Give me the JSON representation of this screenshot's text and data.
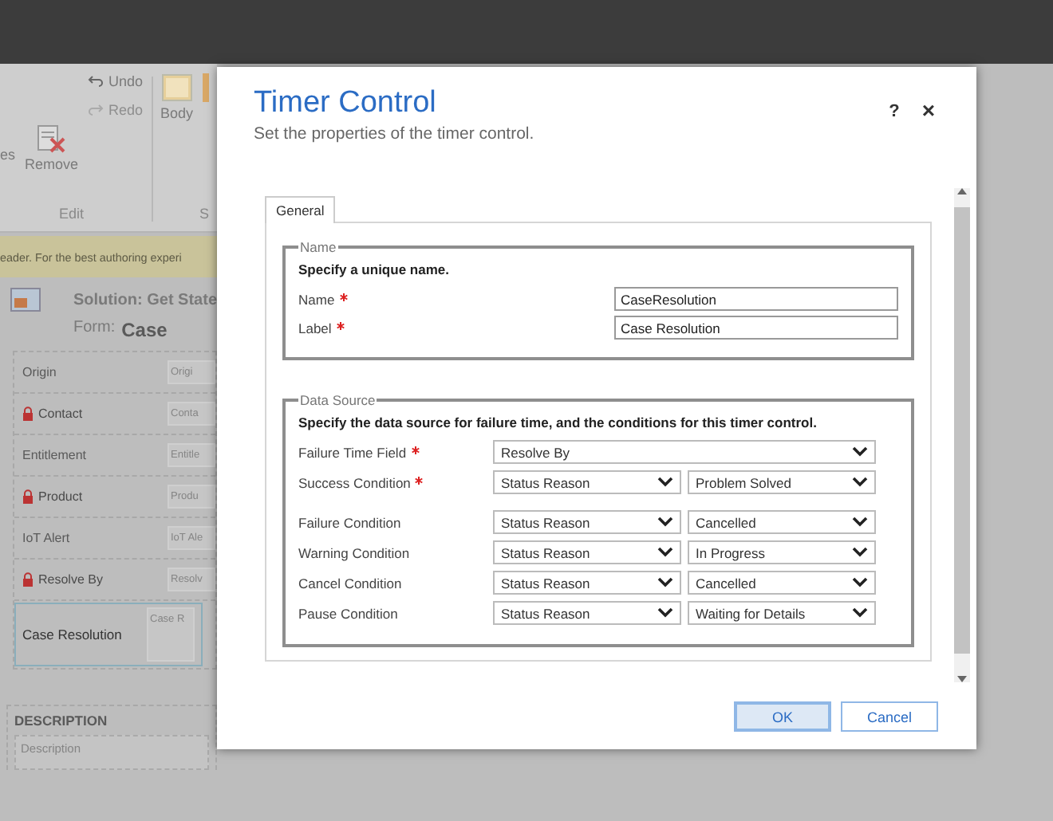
{
  "ribbon": {
    "fragment": "es",
    "remove": "Remove",
    "undo": "Undo",
    "redo": "Redo",
    "redo_disabled": true,
    "body": "Body",
    "group_label": "Edit",
    "group_label_2": "S"
  },
  "notice": "eader. For the best authoring experi",
  "solution": "Solution: Get State",
  "form_label": "Form:",
  "form_name": "Case",
  "fields": [
    {
      "label": "Origin",
      "locked": false,
      "placeholder": "Origi",
      "selected": false
    },
    {
      "label": "Contact",
      "locked": true,
      "placeholder": "Conta",
      "selected": false
    },
    {
      "label": "Entitlement",
      "locked": false,
      "placeholder": "Entitle",
      "selected": false
    },
    {
      "label": "Product",
      "locked": true,
      "placeholder": "Produ",
      "selected": false
    },
    {
      "label": "IoT Alert",
      "locked": false,
      "placeholder": "IoT Ale",
      "selected": false
    },
    {
      "label": "Resolve By",
      "locked": true,
      "placeholder": "Resolv",
      "selected": false
    },
    {
      "label": "Case Resolution",
      "locked": false,
      "placeholder": "Case R",
      "selected": true
    }
  ],
  "description": {
    "heading": "DESCRIPTION",
    "placeholder": "Description"
  },
  "dialog": {
    "title": "Timer Control",
    "subtitle": "Set the properties of the timer control.",
    "help": "?",
    "close": "×",
    "tabs": [
      {
        "label": "General",
        "selected": true
      }
    ],
    "name_section": {
      "legend": "Name",
      "instruction": "Specify a unique name.",
      "fields": [
        {
          "label": "Name",
          "required": true,
          "value": "CaseResolution"
        },
        {
          "label": "Label",
          "required": true,
          "value": "Case Resolution"
        }
      ]
    },
    "data_source": {
      "legend": "Data Source",
      "instruction": "Specify the data source for failure time, and the conditions for this timer control.",
      "rows": [
        {
          "label": "Failure Time Field",
          "required": true,
          "selects": [
            "Resolve By"
          ]
        },
        {
          "label": "Success Condition",
          "required": true,
          "selects": [
            "Status Reason",
            "Problem Solved"
          ]
        },
        {
          "label": "Failure Condition",
          "required": false,
          "selects": [
            "Status Reason",
            "Cancelled"
          ]
        },
        {
          "label": "Warning Condition",
          "required": false,
          "selects": [
            "Status Reason",
            "In Progress"
          ]
        },
        {
          "label": "Cancel Condition",
          "required": false,
          "selects": [
            "Status Reason",
            "Cancelled"
          ]
        },
        {
          "label": "Pause Condition",
          "required": false,
          "selects": [
            "Status Reason",
            "Waiting for Details"
          ]
        }
      ]
    },
    "buttons": [
      {
        "label": "OK",
        "focused": true
      },
      {
        "label": "Cancel",
        "focused": false
      }
    ]
  }
}
